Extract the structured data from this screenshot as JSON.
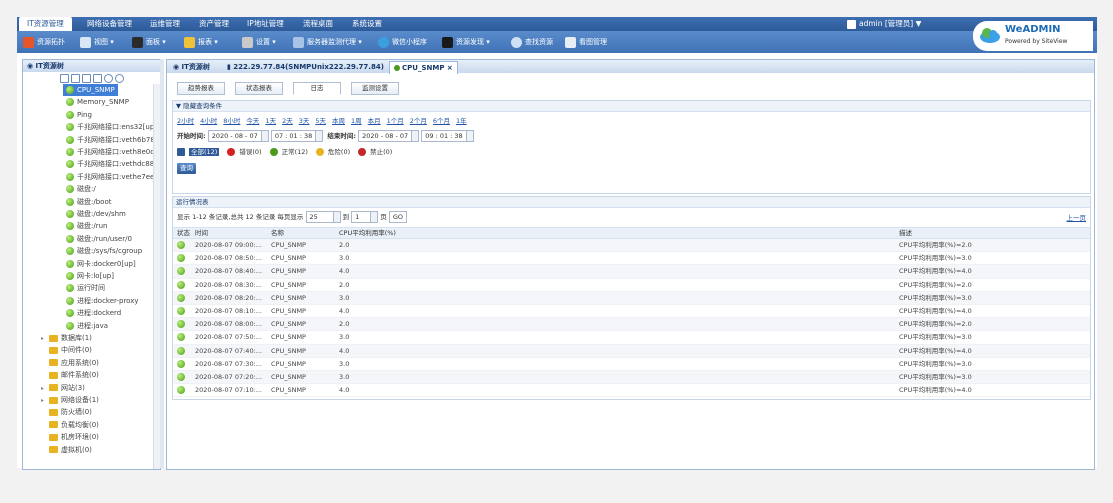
{
  "menubar": [
    "IT资源管理",
    "网络设备管理",
    "运维管理",
    "资产管理",
    "IP地址管理",
    "流程桌面",
    "系统设置"
  ],
  "toolbar": [
    "资源拓扑",
    "视图",
    "面板",
    "报表",
    "设置",
    "服务器监测代理",
    "微信小程序",
    "资源发现",
    "查找资源",
    "看图管理"
  ],
  "user": "admin [管理员] ▼",
  "logo": {
    "brand": "WeADMIN",
    "powered": "Powered by SiteView"
  },
  "tree": {
    "header": "IT资源树",
    "items": [
      {
        "label": "CPU_SNMP",
        "type": "leaf",
        "selected": true
      },
      {
        "label": "Memory_SNMP",
        "type": "leaf"
      },
      {
        "label": "Ping",
        "type": "leaf"
      },
      {
        "label": "千兆网络接口:ens32[up]",
        "type": "leaf"
      },
      {
        "label": "千兆网络接口:veth6b78",
        "type": "leaf"
      },
      {
        "label": "千兆网络接口:veth8e0d",
        "type": "leaf"
      },
      {
        "label": "千兆网络接口:vethdc887",
        "type": "leaf"
      },
      {
        "label": "千兆网络接口:vethe7ee2",
        "type": "leaf"
      },
      {
        "label": "磁盘:/",
        "type": "leaf"
      },
      {
        "label": "磁盘:/boot",
        "type": "leaf"
      },
      {
        "label": "磁盘:/dev/shm",
        "type": "leaf"
      },
      {
        "label": "磁盘:/run",
        "type": "leaf"
      },
      {
        "label": "磁盘:/run/user/0",
        "type": "leaf"
      },
      {
        "label": "磁盘:/sys/fs/cgroup",
        "type": "leaf"
      },
      {
        "label": "网卡:docker0[up]",
        "type": "leaf"
      },
      {
        "label": "网卡:lo[up]",
        "type": "leaf"
      },
      {
        "label": "运行时间",
        "type": "leaf"
      },
      {
        "label": "进程:docker-proxy",
        "type": "leaf"
      },
      {
        "label": "进程:dockerd",
        "type": "leaf"
      },
      {
        "label": "进程:java",
        "type": "leaf"
      },
      {
        "label": "数据库(1)",
        "type": "folder",
        "expandable": true
      },
      {
        "label": "中间件(0)",
        "type": "folder"
      },
      {
        "label": "应用系统(0)",
        "type": "folder"
      },
      {
        "label": "邮件系统(0)",
        "type": "folder"
      },
      {
        "label": "网站(3)",
        "type": "folder",
        "expandable": true
      },
      {
        "label": "网络设备(1)",
        "type": "folder",
        "expandable": true
      },
      {
        "label": "防火墙(0)",
        "type": "folder"
      },
      {
        "label": "负载均衡(0)",
        "type": "folder"
      },
      {
        "label": "机房环境(0)",
        "type": "folder"
      },
      {
        "label": "虚拟机(0)",
        "type": "folder"
      }
    ]
  },
  "tabs": [
    "IT资源树",
    "222.29.77.84(SNMPUnix222.29.77.84)",
    "CPU_SNMP ×"
  ],
  "subtabs": [
    "趋势报表",
    "状态报表",
    "日志",
    "监测设置"
  ],
  "query": {
    "header": "▼ 隐藏查询条件",
    "quick": [
      "2小时",
      "4小时",
      "8小时",
      "今天",
      "1天",
      "2天",
      "3天",
      "5天",
      "本周",
      "1周",
      "本月",
      "1个月",
      "2个月",
      "6个月",
      "1年"
    ],
    "start_label": "开始时间:",
    "start_date": "2020 - 08 - 07",
    "start_time": "07 : 01 : 38",
    "end_label": "结束时间:",
    "end_date": "2020 - 08 - 07",
    "end_time": "09 : 01 : 38",
    "filters": [
      {
        "label": "全部(12)",
        "color": "#2e5a98"
      },
      {
        "label": "错误(0)",
        "color": "#d42020"
      },
      {
        "label": "正常(12)",
        "color": "#4b9a1a"
      },
      {
        "label": "危险(0)",
        "color": "#e8b320"
      },
      {
        "label": "禁止(0)",
        "color": "#c0282d"
      }
    ],
    "button": "查询"
  },
  "log": {
    "header": "运行情况表",
    "pager": {
      "text1": "显示 1-12 条记录,总共 12 条记录 每页显示",
      "size": "25",
      "text2": "到",
      "page": "1",
      "text3": "页",
      "go": "GO"
    },
    "prevnext": "上一页",
    "columns": [
      "状态",
      "时间",
      "名称",
      "CPU平均利用率(%)",
      "描述"
    ],
    "rows": [
      {
        "time": "2020-08-07 09:00:...",
        "name": "CPU_SNMP",
        "value": "2.0",
        "desc": "CPU平均利用率(%)=2.0"
      },
      {
        "time": "2020-08-07 08:50:...",
        "name": "CPU_SNMP",
        "value": "3.0",
        "desc": "CPU平均利用率(%)=3.0"
      },
      {
        "time": "2020-08-07 08:40:...",
        "name": "CPU_SNMP",
        "value": "4.0",
        "desc": "CPU平均利用率(%)=4.0"
      },
      {
        "time": "2020-08-07 08:30:...",
        "name": "CPU_SNMP",
        "value": "2.0",
        "desc": "CPU平均利用率(%)=2.0"
      },
      {
        "time": "2020-08-07 08:20:...",
        "name": "CPU_SNMP",
        "value": "3.0",
        "desc": "CPU平均利用率(%)=3.0"
      },
      {
        "time": "2020-08-07 08:10:...",
        "name": "CPU_SNMP",
        "value": "4.0",
        "desc": "CPU平均利用率(%)=4.0"
      },
      {
        "time": "2020-08-07 08:00:...",
        "name": "CPU_SNMP",
        "value": "2.0",
        "desc": "CPU平均利用率(%)=2.0"
      },
      {
        "time": "2020-08-07 07:50:...",
        "name": "CPU_SNMP",
        "value": "3.0",
        "desc": "CPU平均利用率(%)=3.0"
      },
      {
        "time": "2020-08-07 07:40:...",
        "name": "CPU_SNMP",
        "value": "4.0",
        "desc": "CPU平均利用率(%)=4.0"
      },
      {
        "time": "2020-08-07 07:30:...",
        "name": "CPU_SNMP",
        "value": "3.0",
        "desc": "CPU平均利用率(%)=3.0"
      },
      {
        "time": "2020-08-07 07:20:...",
        "name": "CPU_SNMP",
        "value": "3.0",
        "desc": "CPU平均利用率(%)=3.0"
      },
      {
        "time": "2020-08-07 07:10:...",
        "name": "CPU_SNMP",
        "value": "4.0",
        "desc": "CPU平均利用率(%)=4.0"
      }
    ]
  }
}
